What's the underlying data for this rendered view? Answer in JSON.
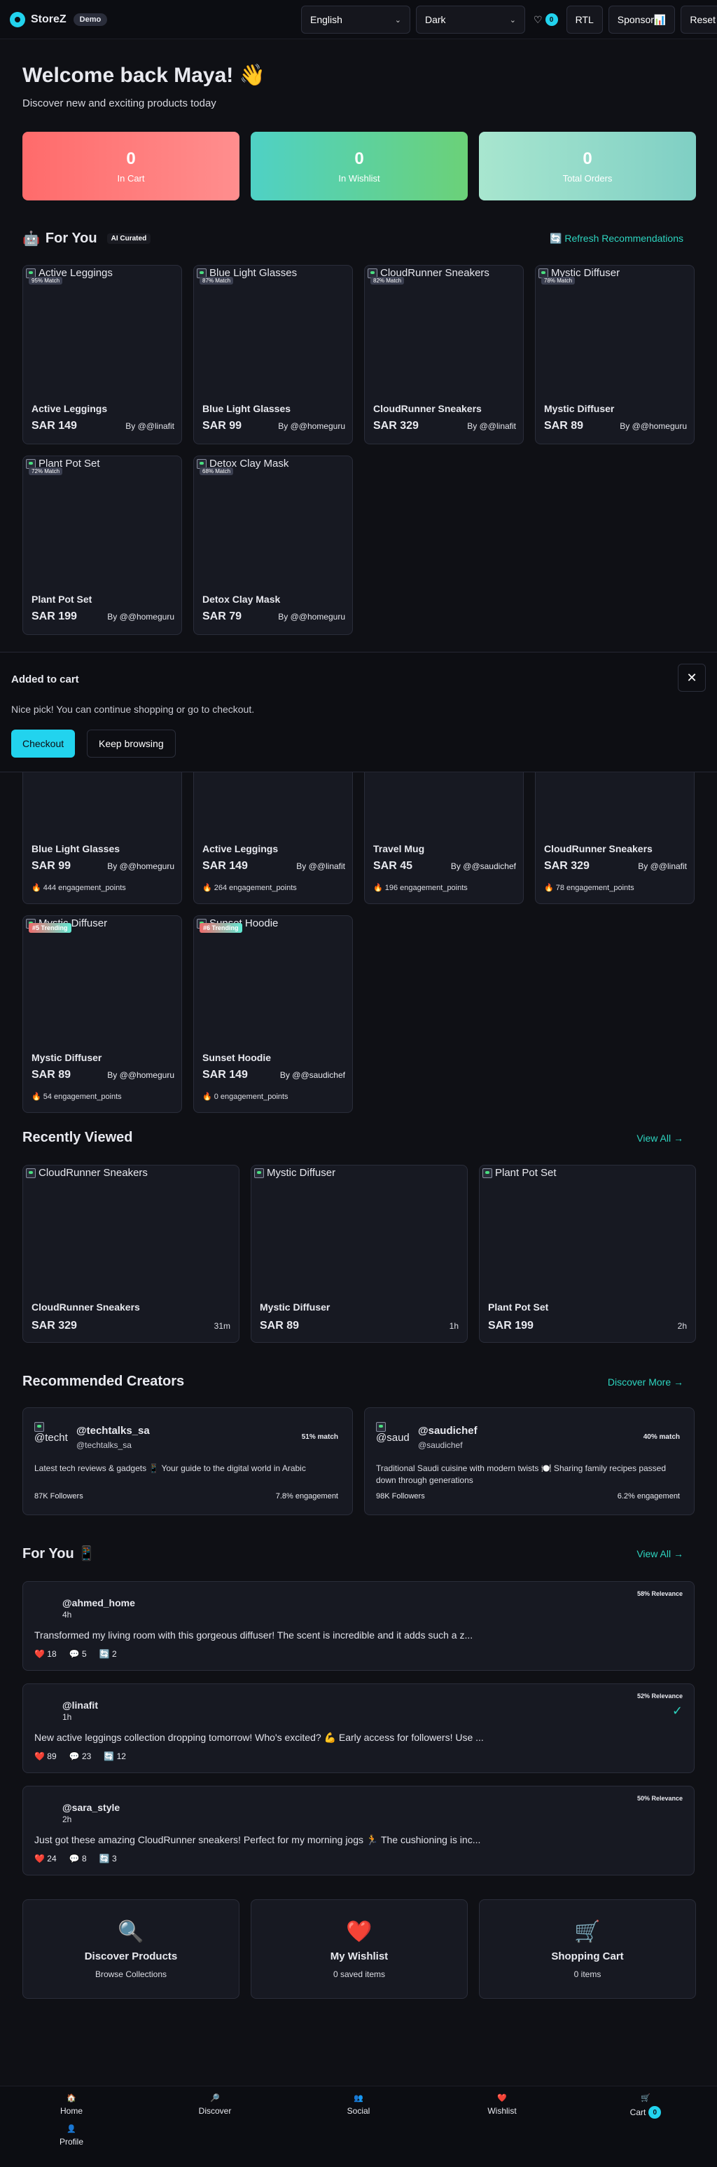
{
  "header": {
    "brand": "StoreZ",
    "demo_badge": "Demo",
    "language": "English",
    "theme": "Dark",
    "wishlist_count": "0",
    "rtl_label": "RTL",
    "sponsor_label": "Sponsor📊",
    "reset_label": "Reset"
  },
  "welcome": {
    "title": "Welcome back Maya! 👋",
    "subtitle": "Discover new and exciting products today"
  },
  "stats": [
    {
      "value": "0",
      "label": "In Cart"
    },
    {
      "value": "0",
      "label": "In Wishlist"
    },
    {
      "value": "0",
      "label": "Total Orders"
    }
  ],
  "for_you_section": {
    "title": "For You",
    "ai_badge": "AI Curated",
    "refresh_label": "🔄 Refresh Recommendations",
    "products": [
      {
        "alt": "Active Leggings",
        "badge": "95% Match",
        "name": "Active Leggings",
        "price": "SAR 149",
        "by": "By @@linafit"
      },
      {
        "alt": "Blue Light Glasses",
        "badge": "87% Match",
        "name": "Blue Light Glasses",
        "price": "SAR 99",
        "by": "By @@homeguru"
      },
      {
        "alt": "CloudRunner Sneakers",
        "badge": "82% Match",
        "name": "CloudRunner Sneakers",
        "price": "SAR 329",
        "by": "By @@linafit"
      },
      {
        "alt": "Mystic Diffuser",
        "badge": "78% Match",
        "name": "Mystic Diffuser",
        "price": "SAR 89",
        "by": "By @@homeguru"
      },
      {
        "alt": "Plant Pot Set",
        "badge": "72% Match",
        "name": "Plant Pot Set",
        "price": "SAR 199",
        "by": "By @@homeguru"
      },
      {
        "alt": "Detox Clay Mask",
        "badge": "68% Match",
        "name": "Detox Clay Mask",
        "price": "SAR 79",
        "by": "By @@homeguru"
      }
    ]
  },
  "cart_sheet": {
    "title": "Added to cart",
    "message": "Nice pick! You can continue shopping or go to checkout.",
    "checkout_label": "Checkout",
    "keep_label": "Keep browsing",
    "close_symbol": "✕"
  },
  "trending": [
    {
      "name": "Blue Light Glasses",
      "price": "SAR 99",
      "by": "By @@homeguru",
      "eng": "🔥 444 engagement_points"
    },
    {
      "name": "Active Leggings",
      "price": "SAR 149",
      "by": "By @@linafit",
      "eng": "🔥 264 engagement_points"
    },
    {
      "name": "Travel Mug",
      "price": "SAR 45",
      "by": "By @@saudichef",
      "eng": "🔥 196 engagement_points"
    },
    {
      "name": "CloudRunner Sneakers",
      "price": "SAR 329",
      "by": "By @@linafit",
      "eng": "🔥 78 engagement_points"
    },
    {
      "alt": "Mystic Diffuser",
      "badge": "#5 Trending",
      "name": "Mystic Diffuser",
      "price": "SAR 89",
      "by": "By @@homeguru",
      "eng": "🔥 54 engagement_points"
    },
    {
      "alt": "Sunset Hoodie",
      "badge": "#6 Trending",
      "name": "Sunset Hoodie",
      "price": "SAR 149",
      "by": "By @@saudichef",
      "eng": "🔥 0 engagement_points"
    }
  ],
  "recent": {
    "title": "Recently Viewed",
    "view_all": "View All →",
    "items": [
      {
        "alt": "CloudRunner Sneakers",
        "name": "CloudRunner Sneakers",
        "price": "SAR 329",
        "time": "31m"
      },
      {
        "alt": "Mystic Diffuser",
        "name": "Mystic Diffuser",
        "price": "SAR 89",
        "time": "1h"
      },
      {
        "alt": "Plant Pot Set",
        "name": "Plant Pot Set",
        "price": "SAR 199",
        "time": "2h"
      }
    ]
  },
  "creators": {
    "title": "Recommended Creators",
    "discover": "Discover More →",
    "items": [
      {
        "avatar_alt": "@techt",
        "name": "@techtalks_sa",
        "handle": "@techtalks_sa",
        "match": "51% match",
        "bio": "Latest tech reviews & gadgets 📱 Your guide to the digital world in Arabic",
        "followers": "87K Followers",
        "engagement": "7.8% engagement"
      },
      {
        "avatar_alt": "@saudi",
        "name": "@saudichef",
        "handle": "@saudichef",
        "match": "40% match",
        "bio": "Traditional Saudi cuisine with modern twists 🍽️ Sharing family recipes passed down through generations",
        "followers": "98K Followers",
        "engagement": "6.2% engagement"
      }
    ]
  },
  "feed": {
    "title": "For You 📱",
    "view_all": "View All →",
    "posts": [
      {
        "user": "@ahmed_home",
        "time": "4h",
        "relevance": "58% Relevance",
        "text": "Transformed my living room with this gorgeous diffuser! The scent is incredible and it adds such a z...",
        "likes": "18",
        "comments": "5",
        "shares": "2"
      },
      {
        "user": "@linafit",
        "time": "1h",
        "relevance": "52% Relevance",
        "text": "New active leggings collection dropping tomorrow! Who's excited? 💪 Early access for followers! Use ...",
        "likes": "89",
        "comments": "23",
        "shares": "12"
      },
      {
        "user": "@sara_style",
        "time": "2h",
        "relevance": "50% Relevance",
        "text": "Just got these amazing CloudRunner sneakers! Perfect for my morning jogs 🏃 The cushioning is inc...",
        "likes": "24",
        "comments": "8",
        "shares": "3"
      }
    ]
  },
  "quick_links": [
    {
      "icon": "🔍",
      "title": "Discover Products",
      "sub": "Browse Collections"
    },
    {
      "icon": "❤️",
      "title": "My Wishlist",
      "sub": "0 saved items"
    },
    {
      "icon": "🛒",
      "title": "Shopping Cart",
      "sub": "0 items"
    }
  ],
  "nav": {
    "home": "Home",
    "discover": "Discover",
    "social": "Social",
    "wishlist": "Wishlist",
    "cart": "Cart",
    "cart_count": "0",
    "profile": "Profile"
  },
  "colors": {
    "accent": "#22d3ee",
    "teal_link": "#2dd4bf",
    "stat_cart": "#ff7a7a",
    "stat_wishlist": "#4fd1c5",
    "stat_orders": "#a8e6cf"
  }
}
